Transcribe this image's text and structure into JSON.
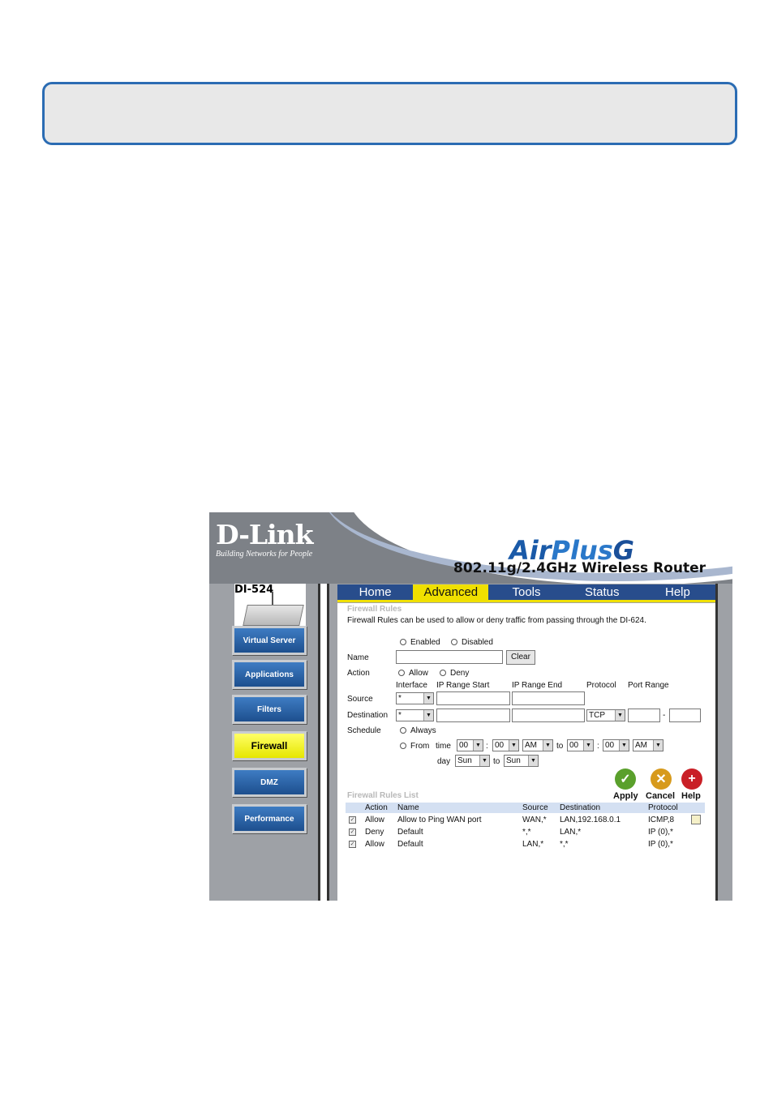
{
  "brand": {
    "name": "D-Link",
    "tagline": "Building Networks for People"
  },
  "product": {
    "part1": "Air",
    "part2": "Plus",
    "part3": "G",
    "subtitle": "802.11g/2.4GHz Wireless Router"
  },
  "device": {
    "model": "DI-524"
  },
  "tabs": [
    {
      "label": "Home"
    },
    {
      "label": "Advanced"
    },
    {
      "label": "Tools"
    },
    {
      "label": "Status"
    },
    {
      "label": "Help"
    }
  ],
  "sidebar": {
    "items": [
      {
        "label": "Virtual Server"
      },
      {
        "label": "Applications"
      },
      {
        "label": "Filters"
      },
      {
        "label": "Firewall"
      },
      {
        "label": "DMZ"
      },
      {
        "label": "Performance"
      }
    ]
  },
  "firewall": {
    "title": "Firewall Rules",
    "description": "Firewall Rules can be used to allow or deny traffic from passing through the DI-624.",
    "enabled_label": "Enabled",
    "disabled_label": "Disabled",
    "name_label": "Name",
    "clear_button": "Clear",
    "action_label": "Action",
    "allow_label": "Allow",
    "deny_label": "Deny",
    "col_interface": "Interface",
    "col_ip_start": "IP Range Start",
    "col_ip_end": "IP Range End",
    "col_protocol": "Protocol",
    "col_port_range": "Port Range",
    "source_label": "Source",
    "destination_label": "Destination",
    "source_interface": "*",
    "dest_interface": "*",
    "protocol_value": "TCP",
    "port_dash": "-",
    "schedule_label": "Schedule",
    "always_label": "Always",
    "from_label": "From",
    "time_label": "time",
    "from_hour": "00",
    "from_min": "00",
    "from_ampm": "AM",
    "to_label": "to",
    "to_hour": "00",
    "to_min": "00",
    "to_ampm": "AM",
    "colon": ":",
    "day_label": "day",
    "day_from": "Sun",
    "day_to_label": "to",
    "day_to": "Sun"
  },
  "actions": {
    "apply": "Apply",
    "cancel": "Cancel",
    "help": "Help"
  },
  "rules_list": {
    "title": "Firewall Rules List",
    "headers": {
      "action": "Action",
      "name": "Name",
      "source": "Source",
      "destination": "Destination",
      "protocol": "Protocol"
    },
    "rows": [
      {
        "action": "Allow",
        "name": "Allow to Ping WAN port",
        "source": "WAN,*",
        "destination": "LAN,192.168.0.1",
        "protocol": "ICMP,8"
      },
      {
        "action": "Deny",
        "name": "Default",
        "source": "*,*",
        "destination": "LAN,*",
        "protocol": "IP (0),*"
      },
      {
        "action": "Allow",
        "name": "Default",
        "source": "LAN,*",
        "destination": "*,*",
        "protocol": "IP (0),*"
      }
    ]
  }
}
